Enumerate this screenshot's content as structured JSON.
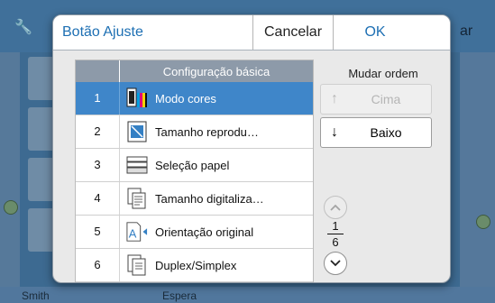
{
  "dialog": {
    "title": "Botão Ajuste",
    "cancel_label": "Cancelar",
    "ok_label": "OK"
  },
  "list": {
    "header": "Configuração básica",
    "rows": [
      {
        "num": "1",
        "label": "Modo cores",
        "icon": "color-mode-icon",
        "selected": true
      },
      {
        "num": "2",
        "label": "Tamanho reprodu…",
        "icon": "reproduction-size-icon",
        "selected": false
      },
      {
        "num": "3",
        "label": "Seleção papel",
        "icon": "paper-tray-icon",
        "selected": false
      },
      {
        "num": "4",
        "label": "Tamanho digitaliza…",
        "icon": "scan-size-icon",
        "selected": false
      },
      {
        "num": "5",
        "label": "Orientação original",
        "icon": "original-orientation-icon",
        "selected": false
      },
      {
        "num": "6",
        "label": "Duplex/Simplex",
        "icon": "duplex-icon",
        "selected": false
      }
    ]
  },
  "order": {
    "label": "Mudar ordem",
    "up_label": "Cima",
    "down_label": "Baixo"
  },
  "pagination": {
    "current": "1",
    "total": "6"
  },
  "background": {
    "header_fragment": "ar",
    "status_left": "Smith",
    "status_mid": "Espera"
  },
  "colors": {
    "accent": "#1d6fb3",
    "selection": "#3f86c9",
    "list_header": "#8d9aa9"
  }
}
